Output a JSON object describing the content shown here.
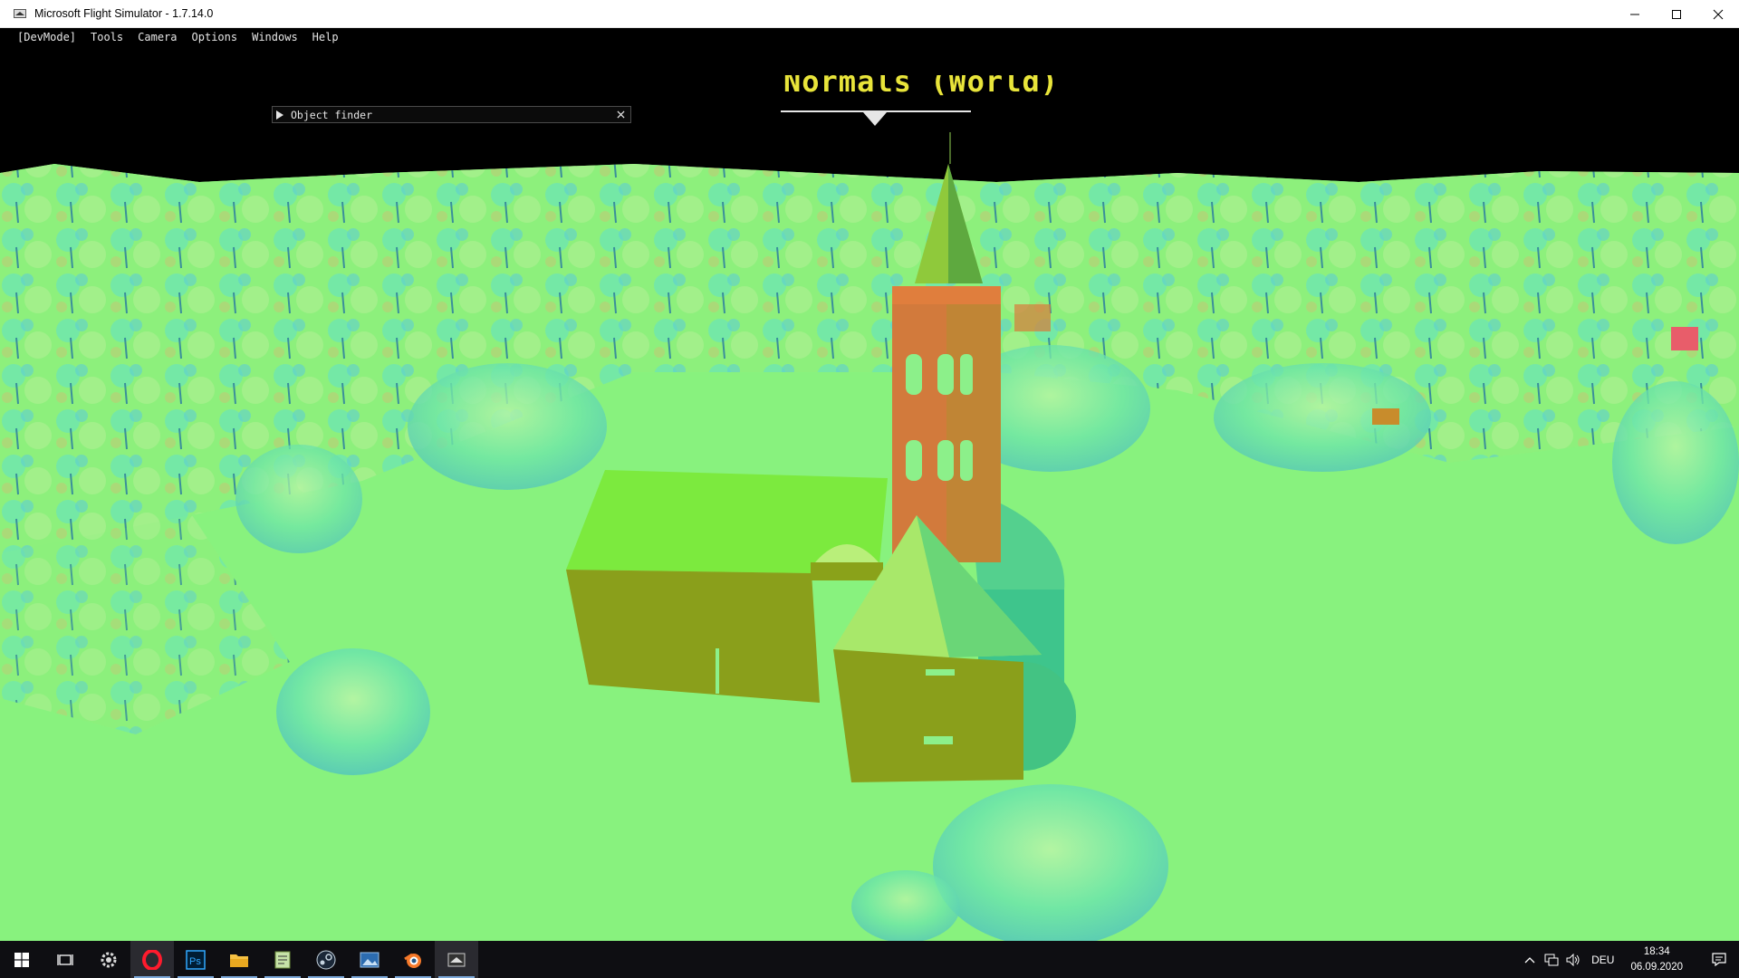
{
  "window": {
    "title": "Microsoft Flight Simulator - 1.7.14.0",
    "controls": [
      "minimize-icon",
      "maximize-icon",
      "close-icon"
    ]
  },
  "menubar": {
    "items": [
      "[DevMode]",
      "Tools",
      "Camera",
      "Options",
      "Windows",
      "Help"
    ]
  },
  "object_finder": {
    "label": "Object finder",
    "icons": [
      "collapse-arrow-icon",
      "close-icon"
    ]
  },
  "hud": {
    "heading_text": "Normals (World)"
  },
  "colors": {
    "ground": "#86f47f",
    "trees": "#5fe3a0",
    "tower": "#d2793b",
    "building": "#8aa21a",
    "sky": "#000000",
    "heading": "#e8e43a"
  },
  "taskbar": {
    "apps": [
      {
        "name": "windows-start-icon"
      },
      {
        "name": "task-view-icon"
      },
      {
        "name": "settings-gear-icon"
      },
      {
        "name": "opera-icon"
      },
      {
        "name": "photoshop-icon",
        "label": "Ps"
      },
      {
        "name": "file-explorer-icon"
      },
      {
        "name": "notepad-icon"
      },
      {
        "name": "steam-icon"
      },
      {
        "name": "image-viewer-icon"
      },
      {
        "name": "blender-icon"
      },
      {
        "name": "flight-simulator-icon"
      }
    ],
    "tray": {
      "language": "DEU",
      "time": "18:34",
      "date": "06.09.2020",
      "icons": [
        "chevron-up-icon",
        "network-icon",
        "volume-icon",
        "notification-icon"
      ]
    }
  }
}
